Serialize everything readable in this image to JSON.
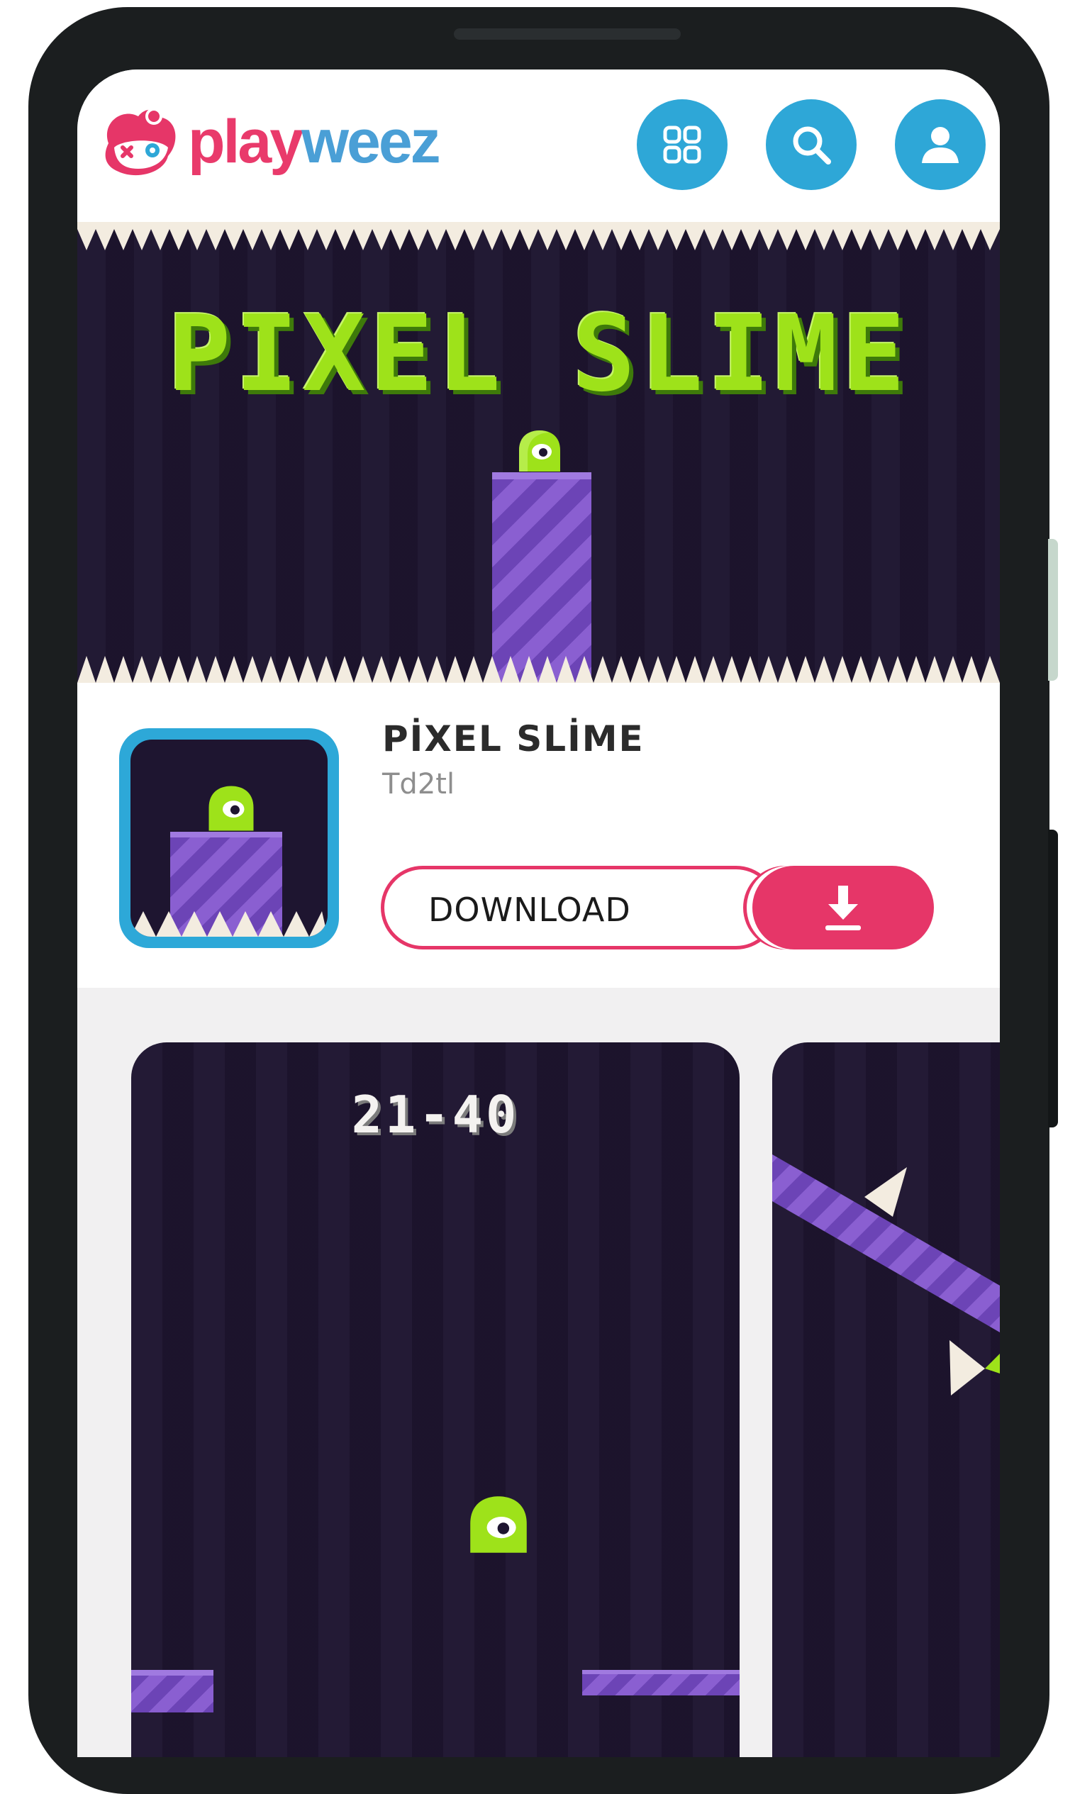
{
  "header": {
    "logo_play": "play",
    "logo_weez": "weez",
    "nav_buttons": [
      {
        "icon": "grid-icon"
      },
      {
        "icon": "search-icon"
      },
      {
        "icon": "user-icon"
      }
    ]
  },
  "banner": {
    "title": "PIXEL SLIME"
  },
  "game": {
    "title": "PİXEL SLİME",
    "author": "Td2tl",
    "download_label": "DOWNLOAD"
  },
  "screenshots": [
    {
      "level_text": "21-40"
    },
    {
      "level_text": ""
    }
  ],
  "colors": {
    "brand_pink": "#e63668",
    "brand_blue": "#2ea7d7",
    "game_bg": "#1e1530",
    "slime_green": "#9ee21a",
    "platform_purple": "#6c44b6"
  }
}
